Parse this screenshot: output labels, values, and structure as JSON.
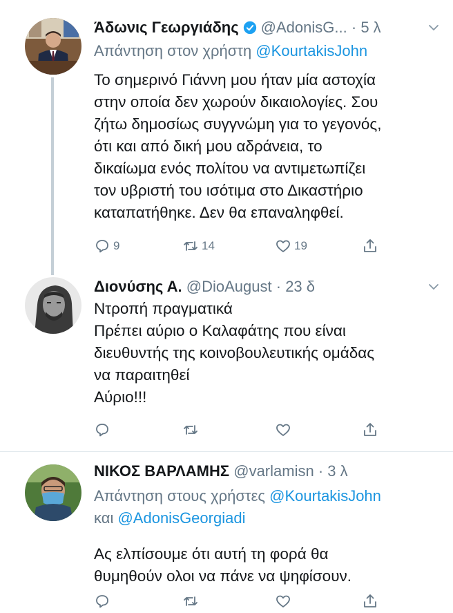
{
  "tweets": [
    {
      "name": "Άδωνις Γεωργιάδης",
      "handle": "@AdonisG...",
      "dot": "·",
      "time": "5 λ",
      "verified": true,
      "reply_prefix": "Απάντηση στον χρήστη",
      "reply_mentions": [
        "@KourtakisJohn"
      ],
      "reply_joiner": "",
      "lines": [
        "Το σημερινό Γιάννη μου ήταν μία αστοχία",
        "στην οποία δεν χωρούν δικαιολογίες. Σου",
        "ζήτω δημοσίως συγγνώμη για το γεγονός,",
        "ότι και από δική μου αδράνεια, το",
        "δικαίωμα ενός πολίτου να αντιμετωπίζει",
        "τον υβριστή του ισότιμα στο Δικαστήριο",
        "καταπατήθηκε. Δεν θα επαναληφθεί."
      ],
      "replies": "9",
      "retweets": "14",
      "likes": "19"
    },
    {
      "name": "Διονύσης Α.",
      "handle": "@DioAugust",
      "dot": "·",
      "time": "23 δ",
      "verified": false,
      "lines": [
        "Ντροπή πραγματικά",
        "Πρέπει αύριο ο Καλαφάτης που είναι",
        "διευθυντής της κοινοβουλευτικής ομάδας",
        "να παραιτηθεί",
        "Αύριο!!!"
      ],
      "replies": "",
      "retweets": "",
      "likes": ""
    },
    {
      "name": "ΝΙΚΟΣ ΒΑΡΛΑΜΗΣ",
      "handle": "@varlamisn",
      "dot": "·",
      "time": "3 λ",
      "verified": false,
      "reply_prefix": "Απάντηση στους χρήστες",
      "reply_mentions": [
        "@KourtakisJohn",
        "@AdonisGeorgiadi"
      ],
      "reply_joiner": "και",
      "lines": [
        "Ας ελπίσουμε ότι αυτή τη φορά θα",
        "θυμηθούν ολοι να πάνε να ψηφίσουν."
      ],
      "replies": "",
      "retweets": "",
      "likes": ""
    }
  ],
  "colors": {
    "accent": "#1b95e0",
    "secondary_text": "#657786",
    "verified": "#1da1f2",
    "thread_line": "#c4cfd6"
  },
  "icons": [
    "reply-icon",
    "retweet-icon",
    "like-icon",
    "share-icon",
    "verified-badge-icon",
    "chevron-down-icon"
  ]
}
